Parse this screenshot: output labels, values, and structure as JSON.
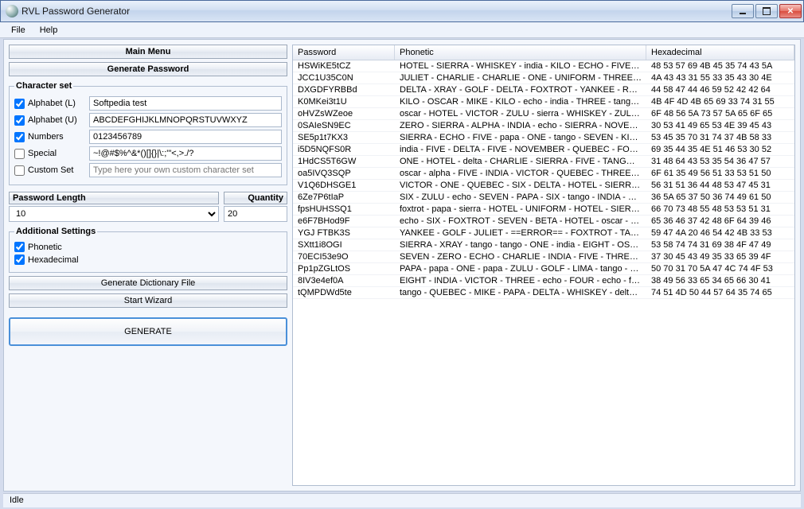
{
  "window": {
    "title": "RVL Password Generator"
  },
  "menubar": [
    "File",
    "Help"
  ],
  "buttons": {
    "main_menu": "Main Menu",
    "generate_password": "Generate Password",
    "generate_dict": "Generate Dictionary File",
    "start_wizard": "Start Wizard",
    "generate": "GENERATE"
  },
  "charset": {
    "legend": "Character set",
    "rows": [
      {
        "name": "alphabet-lower",
        "label": "Alphabet (L)",
        "checked": true,
        "value": "Softpedia test"
      },
      {
        "name": "alphabet-upper",
        "label": "Alphabet (U)",
        "checked": true,
        "value": "ABCDEFGHIJKLMNOPQRSTUVWXYZ"
      },
      {
        "name": "numbers",
        "label": "Numbers",
        "checked": true,
        "value": "0123456789"
      },
      {
        "name": "special",
        "label": "Special",
        "checked": false,
        "value": "~!@#$%^&*()[]{}|\\:;'\"<,>./?"
      },
      {
        "name": "custom-set",
        "label": "Custom Set",
        "checked": false,
        "value": "",
        "placeholder": "Type here your own custom character set"
      }
    ]
  },
  "length": {
    "label": "Password Length",
    "value": "10"
  },
  "quantity": {
    "label": "Quantity",
    "value": "20"
  },
  "additional": {
    "legend": "Additional Settings",
    "phonetic": {
      "label": "Phonetic",
      "checked": true
    },
    "hex": {
      "label": "Hexadecimal",
      "checked": true
    }
  },
  "columns": [
    "Password",
    "Phonetic",
    "Hexadecimal"
  ],
  "results": [
    {
      "pwd": "HSWiKE5tCZ",
      "phon": "HOTEL - SIERRA - WHISKEY - india - KILO - ECHO - FIVE - tang…",
      "hex": "48 53 57 69 4B 45 35 74 43 5A"
    },
    {
      "pwd": "JCC1U35C0N",
      "phon": "JULIET - CHARLIE - CHARLIE - ONE - UNIFORM - THREE - FIV…",
      "hex": "4A 43 43 31 55 33 35 43 30 4E"
    },
    {
      "pwd": "DXGDFYRBBd",
      "phon": "DELTA - XRAY - GOLF - DELTA - FOXTROT - YANKEE - ROME…",
      "hex": "44 58 47 44 46 59 52 42 42 64"
    },
    {
      "pwd": "K0MKei3t1U",
      "phon": "KILO - OSCAR - MIKE - KILO - echo - india - THREE - tango - ON…",
      "hex": "4B 4F 4D 4B 65 69 33 74 31 55"
    },
    {
      "pwd": "oHVZsWZeoe",
      "phon": "oscar - HOTEL - VICTOR - ZULU - sierra - WHISKEY - ZULU - ec…",
      "hex": "6F 48 56 5A 73 57 5A 65 6F 65"
    },
    {
      "pwd": "0SAIeSN9EC",
      "phon": "ZERO - SIERRA - ALPHA - INDIA - echo - SIERRA - NOVEMBE…",
      "hex": "30 53 41 49 65 53 4E 39 45 43"
    },
    {
      "pwd": "SE5p1t7KX3",
      "phon": "SIERRA - ECHO - FIVE - papa - ONE - tango - SEVEN - KILO - X…",
      "hex": "53 45 35 70 31 74 37 4B 58 33"
    },
    {
      "pwd": "i5D5NQFS0R",
      "phon": "india - FIVE - DELTA - FIVE - NOVEMBER - QUEBEC - FOXTRO…",
      "hex": "69 35 44 35 4E 51 46 53 30 52"
    },
    {
      "pwd": "1HdCS5T6GW",
      "phon": "ONE - HOTEL - delta - CHARLIE - SIERRA - FIVE - TANGO - SIX…",
      "hex": "31 48 64 43 53 35 54 36 47 57"
    },
    {
      "pwd": "oa5IVQ3SQP",
      "phon": "oscar - alpha - FIVE - INDIA - VICTOR - QUEBEC - THREE - SI…",
      "hex": "6F 61 35 49 56 51 33 53 51 50"
    },
    {
      "pwd": "V1Q6DHSGE1",
      "phon": "VICTOR - ONE - QUEBEC - SIX - DELTA - HOTEL - SIERRA - G…",
      "hex": "56 31 51 36 44 48 53 47 45 31"
    },
    {
      "pwd": "6Ze7P6tIaP",
      "phon": "SIX - ZULU - echo - SEVEN - PAPA - SIX - tango - INDIA - alpha …",
      "hex": "36 5A 65 37 50 36 74 49 61 50"
    },
    {
      "pwd": "fpsHUHSSQ1",
      "phon": "foxtrot - papa - sierra - HOTEL - UNIFORM - HOTEL - SIERRA - S…",
      "hex": "66 70 73 48 55 48 53 53 51 31"
    },
    {
      "pwd": "e6F7BHod9F",
      "phon": "echo - SIX - FOXTROT - SEVEN - BETA - HOTEL - oscar - delta - …",
      "hex": "65 36 46 37 42 48 6F 64 39 46"
    },
    {
      "pwd": "YGJ FTBK3S",
      "phon": "YANKEE - GOLF - JULIET - ==ERROR== - FOXTROT - TANGO …",
      "hex": "59 47 4A 20 46 54 42 4B 33 53"
    },
    {
      "pwd": "SXtt1i8OGI",
      "phon": "SIERRA - XRAY - tango - tango - ONE - india - EIGHT - OSCAR - …",
      "hex": "53 58 74 74 31 69 38 4F 47 49"
    },
    {
      "pwd": "70ECI53e9O",
      "phon": "SEVEN - ZERO - ECHO - CHARLIE - INDIA - FIVE - THREE - ec…",
      "hex": "37 30 45 43 49 35 33 65 39 4F"
    },
    {
      "pwd": "Pp1pZGLtOS",
      "phon": "PAPA - papa - ONE - papa - ZULU - GOLF - LIMA - tango - OSCA…",
      "hex": "50 70 31 70 5A 47 4C 74 4F 53"
    },
    {
      "pwd": "8IV3e4ef0A",
      "phon": "EIGHT - INDIA - VICTOR - THREE - echo - FOUR - echo - foxtrot…",
      "hex": "38 49 56 33 65 34 65 66 30 41"
    },
    {
      "pwd": "tQMPDWd5te",
      "phon": "tango - QUEBEC - MIKE - PAPA - DELTA - WHISKEY - delta - FI…",
      "hex": "74 51 4D 50 44 57 64 35 74 65"
    }
  ],
  "status": "Idle"
}
